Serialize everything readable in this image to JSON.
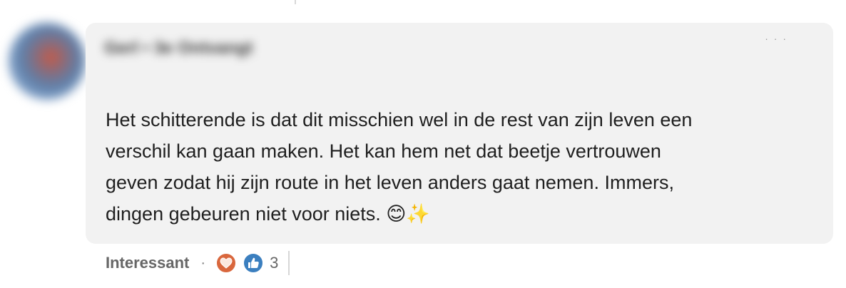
{
  "comment": {
    "author_name": "Gerl • 3e Ontvangt",
    "text": "Het schitterende is dat dit misschien wel in de rest van zijn leven een\nverschil kan gaan maken. Het kan hem net dat beetje vertrouwen\ngeven zodat hij zijn route in het leven anders gaat nemen. Immers,\ndingen gebeuren niet voor niets. 😊✨",
    "menu_icon": "more-icon"
  },
  "actions": {
    "label": "Interessant",
    "separator": "·",
    "reaction_icons": [
      "heart-reaction-icon",
      "thumbs-up-reaction-icon"
    ],
    "reaction_count": "3"
  },
  "colors": {
    "bubble_bg": "#f2f2f2",
    "love_reaction": "#d9673d",
    "like_reaction": "#3b7fbf",
    "text": "#1f1f1f",
    "muted": "#666666"
  }
}
